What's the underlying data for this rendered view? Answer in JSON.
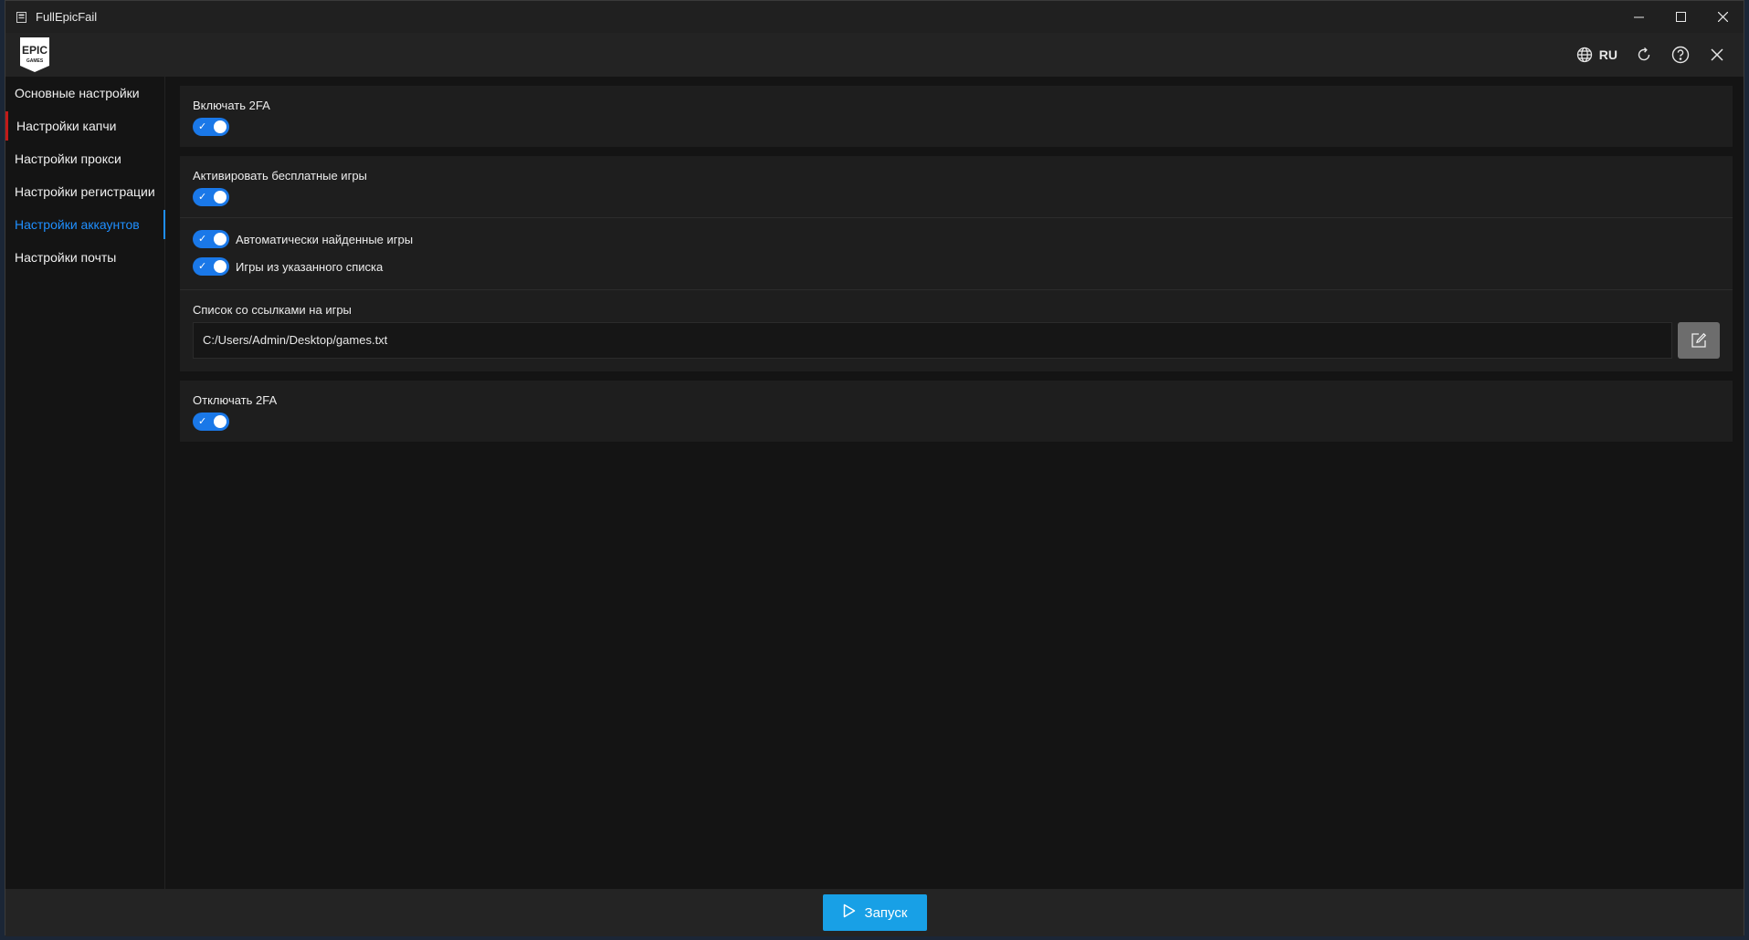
{
  "window": {
    "title": "FullEpicFail"
  },
  "header": {
    "language": "RU",
    "icons": [
      "globe-icon",
      "refresh-icon",
      "help-icon",
      "close-icon"
    ]
  },
  "sidebar": {
    "items": [
      {
        "label": "Основные настройки"
      },
      {
        "label": "Настройки капчи"
      },
      {
        "label": "Настройки прокси"
      },
      {
        "label": "Настройки регистрации"
      },
      {
        "label": "Настройки аккаунтов",
        "active": true
      },
      {
        "label": "Настройки почты"
      }
    ]
  },
  "settings": {
    "enable_2fa": {
      "label": "Включать 2FA",
      "on": true
    },
    "activate_free_games": {
      "label": "Активировать бесплатные игры",
      "on": true
    },
    "auto_found_games": {
      "label": "Автоматически найденные игры",
      "on": true
    },
    "list_games": {
      "label": "Игры из указанного списка",
      "on": true
    },
    "games_list": {
      "label": "Список со ссылками на игры",
      "value": "C:/Users/Admin/Desktop/games.txt"
    },
    "disable_2fa": {
      "label": "Отключать 2FA",
      "on": true
    }
  },
  "footer": {
    "launch_label": "Запуск"
  },
  "colors": {
    "accent": "#1a78e8",
    "active_nav": "#1f8fff",
    "launch": "#18a0e6",
    "captcha_marker": "#c01a1a"
  }
}
